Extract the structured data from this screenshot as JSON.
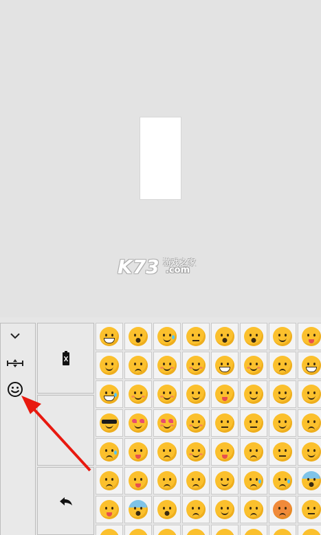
{
  "watermark": {
    "main": "K73",
    "cn": "游戏之家",
    "com": ".com"
  },
  "toolbar": {
    "icons": [
      "chevron-down-icon",
      "resize-icon",
      "smiley-face-icon"
    ],
    "mid_keys": [
      "battery-icon",
      "blank",
      "reply-arrow-icon"
    ]
  },
  "emoji_grid": {
    "rows": [
      [
        "grin",
        "hushed",
        "tears-joy",
        "neutral",
        "surprised",
        "ponder",
        "sleepy",
        "tongue"
      ],
      [
        "confused",
        "frown",
        "pouting-kiss",
        "kiss-closed",
        "grimace",
        "slight-smile",
        "sad",
        "big-grin"
      ],
      [
        "laugh-cry",
        "smile",
        "blush-smile",
        "happy",
        "squint-tongue",
        "wink",
        "relieved",
        "sideeye"
      ],
      [
        "sunglasses",
        "heart-eyes",
        "kiss-heart",
        "kiss-blush",
        "meh",
        "expressionless",
        "smirk",
        "persevere"
      ],
      [
        "cry-sleepy",
        "wink-tongue",
        "tired",
        "flushed",
        "wink-tongue-2",
        "weary",
        "unamused",
        "thinking"
      ],
      [
        "pensive",
        "tongue-out",
        "disappointed",
        "worried",
        "triumph",
        "sad-sweat",
        "crying",
        "fear-blue"
      ],
      [
        "tired-tongue",
        "scared-blue",
        "scream",
        "slight-frown",
        "dizzy",
        "angry",
        "rage",
        "mask"
      ],
      [
        "row8-a",
        "row8-b",
        "row8-c",
        "row8-d",
        "row8-e",
        "row8-f",
        "row8-g",
        "row8-h"
      ]
    ]
  },
  "colors": {
    "emoji_yellow": "#fbc02d",
    "arrow_red": "#e8190f",
    "panel_bg": "#e9e9e9"
  }
}
